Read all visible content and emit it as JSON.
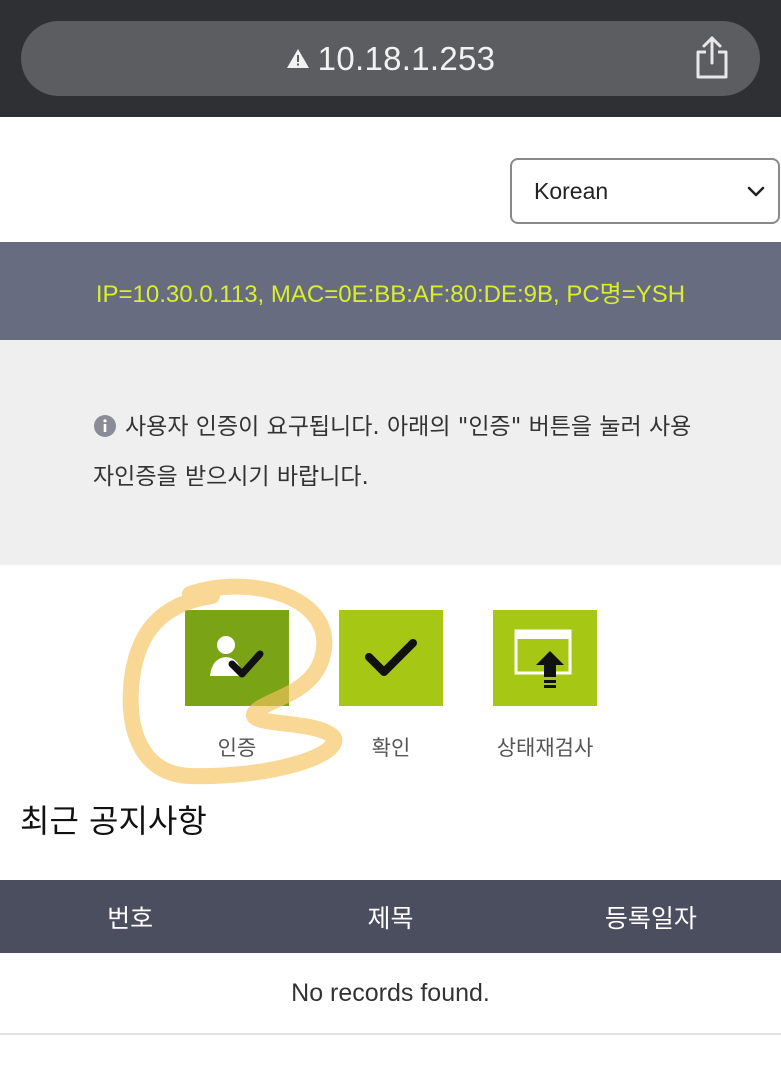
{
  "browser": {
    "url": "10.18.1.253",
    "warning_icon": "warning-triangle-icon",
    "share_icon": "share-icon"
  },
  "language_select": {
    "selected": "Korean",
    "icon": "chevron-down-icon"
  },
  "client_info": {
    "text": "IP=10.30.0.113,  MAC=0E:BB:AF:80:DE:9B,  PC명=YSH"
  },
  "notice": {
    "icon": "info-circle-icon",
    "message": "사용자 인증이 요구됩니다. 아래의 \"인증\" 버튼을 눌러 사용자인증을 받으시기 바랍니다."
  },
  "actions": [
    {
      "label": "인증",
      "icon": "user-check-icon"
    },
    {
      "label": "확인",
      "icon": "checkmark-icon"
    },
    {
      "label": "상태재검사",
      "icon": "window-upload-icon"
    }
  ],
  "colors": {
    "tile_green": "#a6c814",
    "tile_green_dark": "#7aa416",
    "info_text": "#d8ee2e",
    "header_bg": "#686c80",
    "table_head_bg": "#4b4e5f"
  },
  "notices_section": {
    "title": "최근 공지사항",
    "columns": [
      "번호",
      "제목",
      "등록일자"
    ],
    "empty_message": "No records found."
  }
}
